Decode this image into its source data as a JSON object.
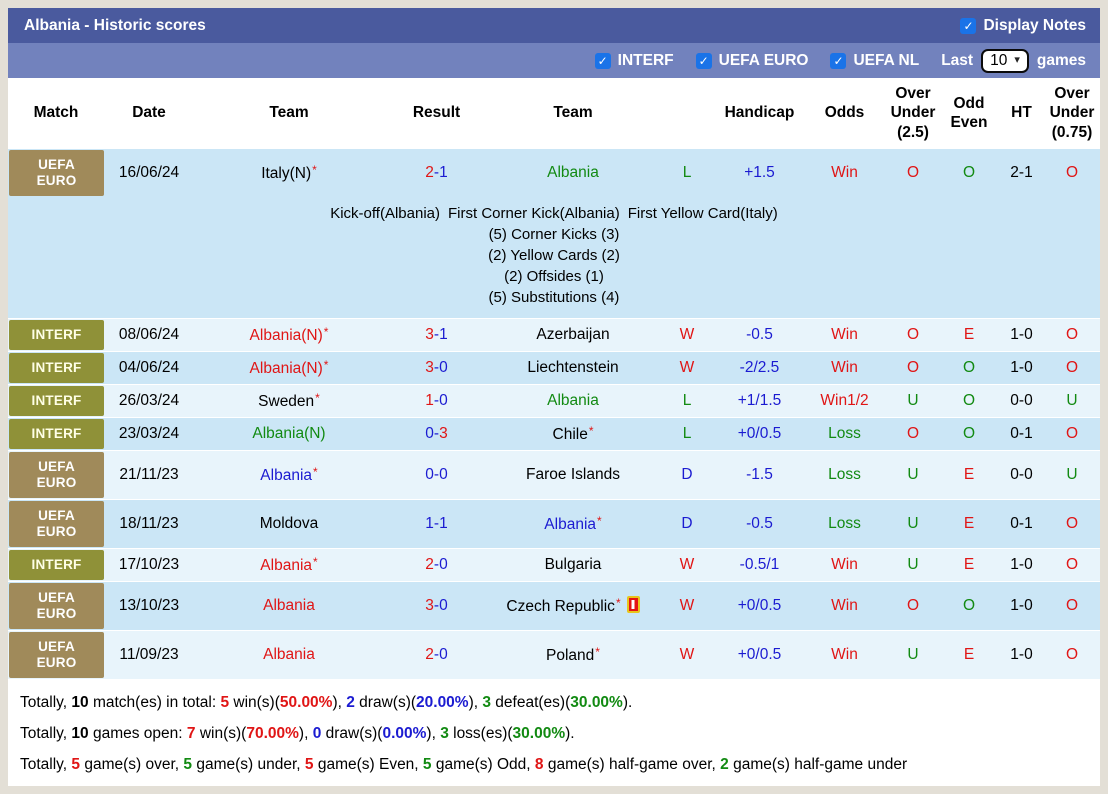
{
  "palette": {
    "title_bar": "#4a5a9e",
    "filter_bar": "#7282bd",
    "row_dark": "#cbe6f6",
    "row_light": "#e8f4fb",
    "badge_gold": "#a08a5a",
    "badge_olive": "#8f9138",
    "win_red": "#e01515",
    "draw_blue": "#1b1bd1",
    "loss_green": "#128a12",
    "checkbox_blue": "#1a73e8"
  },
  "title_bar": {
    "title": "Albania - Historic scores",
    "display_notes_label": "Display Notes",
    "display_notes_checked": true
  },
  "filter_bar": {
    "filters": [
      {
        "label": "INTERF",
        "checked": true
      },
      {
        "label": "UEFA EURO",
        "checked": true
      },
      {
        "label": "UEFA NL",
        "checked": true
      }
    ],
    "last_label": "Last",
    "last_value": "10",
    "games_label": "games"
  },
  "table": {
    "headers": {
      "match": "Match",
      "date": "Date",
      "team1": "Team",
      "result": "Result",
      "team2": "Team",
      "handicap": "Handicap",
      "odds": "Odds",
      "ou25": "Over\nUnder\n(2.5)",
      "oddeven": "Odd\nEven",
      "ht": "HT",
      "ou75": "Over\nUnder\n(0.75)"
    },
    "rows": [
      {
        "comp": "UEFA\nEURO",
        "comp_style": "gold",
        "date": "16/06/24",
        "home": {
          "name": "Italy(N)",
          "star": true,
          "color": "black"
        },
        "score": {
          "h": "2",
          "hc": "red",
          "a": "1",
          "ac": "blue"
        },
        "away": {
          "name": "Albania",
          "star": false,
          "color": "green"
        },
        "wdl": {
          "t": "L",
          "c": "green"
        },
        "hcp": "+1.5",
        "odds": {
          "t": "Win",
          "c": "red"
        },
        "ou25": {
          "t": "O",
          "c": "red"
        },
        "oe": {
          "t": "O",
          "c": "green"
        },
        "ht": "2-1",
        "ou75": {
          "t": "O",
          "c": "red"
        },
        "shade": "dark",
        "notes": {
          "first_events": [
            "Kick-off(Albania)",
            "First Corner Kick(Albania)",
            "First Yellow Card(Italy)"
          ],
          "stat_lines": [
            "(5) Corner Kicks (3)",
            "(2) Yellow Cards (2)",
            "(2) Offsides (1)",
            "(5) Substitutions (4)"
          ]
        }
      },
      {
        "comp": "INTERF",
        "comp_style": "olive",
        "date": "08/06/24",
        "home": {
          "name": "Albania(N)",
          "star": true,
          "color": "red"
        },
        "score": {
          "h": "3",
          "hc": "red",
          "a": "1",
          "ac": "blue"
        },
        "away": {
          "name": "Azerbaijan",
          "star": false,
          "color": "black"
        },
        "wdl": {
          "t": "W",
          "c": "red"
        },
        "hcp": "-0.5",
        "odds": {
          "t": "Win",
          "c": "red"
        },
        "ou25": {
          "t": "O",
          "c": "red"
        },
        "oe": {
          "t": "E",
          "c": "red"
        },
        "ht": "1-0",
        "ou75": {
          "t": "O",
          "c": "red"
        },
        "shade": "light"
      },
      {
        "comp": "INTERF",
        "comp_style": "olive",
        "date": "04/06/24",
        "home": {
          "name": "Albania(N)",
          "star": true,
          "color": "red"
        },
        "score": {
          "h": "3",
          "hc": "red",
          "a": "0",
          "ac": "blue"
        },
        "away": {
          "name": "Liechtenstein",
          "star": false,
          "color": "black"
        },
        "wdl": {
          "t": "W",
          "c": "red"
        },
        "hcp": "-2/2.5",
        "odds": {
          "t": "Win",
          "c": "red"
        },
        "ou25": {
          "t": "O",
          "c": "red"
        },
        "oe": {
          "t": "O",
          "c": "green"
        },
        "ht": "1-0",
        "ou75": {
          "t": "O",
          "c": "red"
        },
        "shade": "dark"
      },
      {
        "comp": "INTERF",
        "comp_style": "olive",
        "date": "26/03/24",
        "home": {
          "name": "Sweden",
          "star": true,
          "color": "black"
        },
        "score": {
          "h": "1",
          "hc": "red",
          "a": "0",
          "ac": "blue"
        },
        "away": {
          "name": "Albania",
          "star": false,
          "color": "green"
        },
        "wdl": {
          "t": "L",
          "c": "green"
        },
        "hcp": "+1/1.5",
        "odds": {
          "t": "Win1/2",
          "c": "red"
        },
        "ou25": {
          "t": "U",
          "c": "green"
        },
        "oe": {
          "t": "O",
          "c": "green"
        },
        "ht": "0-0",
        "ou75": {
          "t": "U",
          "c": "green"
        },
        "shade": "light"
      },
      {
        "comp": "INTERF",
        "comp_style": "olive",
        "date": "23/03/24",
        "home": {
          "name": "Albania(N)",
          "star": false,
          "color": "green"
        },
        "score": {
          "h": "0",
          "hc": "blue",
          "a": "3",
          "ac": "red"
        },
        "away": {
          "name": "Chile",
          "star": true,
          "color": "black"
        },
        "wdl": {
          "t": "L",
          "c": "green"
        },
        "hcp": "+0/0.5",
        "odds": {
          "t": "Loss",
          "c": "green"
        },
        "ou25": {
          "t": "O",
          "c": "red"
        },
        "oe": {
          "t": "O",
          "c": "green"
        },
        "ht": "0-1",
        "ou75": {
          "t": "O",
          "c": "red"
        },
        "shade": "dark"
      },
      {
        "comp": "UEFA\nEURO",
        "comp_style": "gold",
        "date": "21/11/23",
        "home": {
          "name": "Albania",
          "star": true,
          "color": "blue"
        },
        "score": {
          "h": "0",
          "hc": "blue",
          "a": "0",
          "ac": "blue"
        },
        "away": {
          "name": "Faroe Islands",
          "star": false,
          "color": "black"
        },
        "wdl": {
          "t": "D",
          "c": "blue"
        },
        "hcp": "-1.5",
        "odds": {
          "t": "Loss",
          "c": "green"
        },
        "ou25": {
          "t": "U",
          "c": "green"
        },
        "oe": {
          "t": "E",
          "c": "red"
        },
        "ht": "0-0",
        "ou75": {
          "t": "U",
          "c": "green"
        },
        "shade": "light"
      },
      {
        "comp": "UEFA\nEURO",
        "comp_style": "gold",
        "date": "18/11/23",
        "home": {
          "name": "Moldova",
          "star": false,
          "color": "black"
        },
        "score": {
          "h": "1",
          "hc": "blue",
          "a": "1",
          "ac": "blue"
        },
        "away": {
          "name": "Albania",
          "star": true,
          "color": "blue"
        },
        "wdl": {
          "t": "D",
          "c": "blue"
        },
        "hcp": "-0.5",
        "odds": {
          "t": "Loss",
          "c": "green"
        },
        "ou25": {
          "t": "U",
          "c": "green"
        },
        "oe": {
          "t": "E",
          "c": "red"
        },
        "ht": "0-1",
        "ou75": {
          "t": "O",
          "c": "red"
        },
        "shade": "dark"
      },
      {
        "comp": "INTERF",
        "comp_style": "olive",
        "date": "17/10/23",
        "home": {
          "name": "Albania",
          "star": true,
          "color": "red"
        },
        "score": {
          "h": "2",
          "hc": "red",
          "a": "0",
          "ac": "blue"
        },
        "away": {
          "name": "Bulgaria",
          "star": false,
          "color": "black"
        },
        "wdl": {
          "t": "W",
          "c": "red"
        },
        "hcp": "-0.5/1",
        "odds": {
          "t": "Win",
          "c": "red"
        },
        "ou25": {
          "t": "U",
          "c": "green"
        },
        "oe": {
          "t": "E",
          "c": "red"
        },
        "ht": "1-0",
        "ou75": {
          "t": "O",
          "c": "red"
        },
        "shade": "light"
      },
      {
        "comp": "UEFA\nEURO",
        "comp_style": "gold",
        "date": "13/10/23",
        "home": {
          "name": "Albania",
          "star": false,
          "color": "red"
        },
        "score": {
          "h": "3",
          "hc": "red",
          "a": "0",
          "ac": "blue"
        },
        "away": {
          "name": "Czech Republic",
          "star": true,
          "color": "black",
          "red_card": true
        },
        "wdl": {
          "t": "W",
          "c": "red"
        },
        "hcp": "+0/0.5",
        "odds": {
          "t": "Win",
          "c": "red"
        },
        "ou25": {
          "t": "O",
          "c": "red"
        },
        "oe": {
          "t": "O",
          "c": "green"
        },
        "ht": "1-0",
        "ou75": {
          "t": "O",
          "c": "red"
        },
        "shade": "dark"
      },
      {
        "comp": "UEFA\nEURO",
        "comp_style": "gold",
        "date": "11/09/23",
        "home": {
          "name": "Albania",
          "star": false,
          "color": "red"
        },
        "score": {
          "h": "2",
          "hc": "red",
          "a": "0",
          "ac": "blue"
        },
        "away": {
          "name": "Poland",
          "star": true,
          "color": "black"
        },
        "wdl": {
          "t": "W",
          "c": "red"
        },
        "hcp": "+0/0.5",
        "odds": {
          "t": "Win",
          "c": "red"
        },
        "ou25": {
          "t": "U",
          "c": "green"
        },
        "oe": {
          "t": "E",
          "c": "red"
        },
        "ht": "1-0",
        "ou75": {
          "t": "O",
          "c": "red"
        },
        "shade": "light"
      }
    ]
  },
  "footer": {
    "lines": [
      [
        {
          "t": "Totally, "
        },
        {
          "t": "10",
          "b": true
        },
        {
          "t": " match(es) in total: "
        },
        {
          "t": "5",
          "c": "red",
          "b": true
        },
        {
          "t": " win(s)("
        },
        {
          "t": "50.00%",
          "c": "red",
          "b": true
        },
        {
          "t": "), "
        },
        {
          "t": "2",
          "c": "blue",
          "b": true
        },
        {
          "t": " draw(s)("
        },
        {
          "t": "20.00%",
          "c": "blue",
          "b": true
        },
        {
          "t": "), "
        },
        {
          "t": "3",
          "c": "green",
          "b": true
        },
        {
          "t": " defeat(es)("
        },
        {
          "t": "30.00%",
          "c": "green",
          "b": true
        },
        {
          "t": ")."
        }
      ],
      [
        {
          "t": "Totally, "
        },
        {
          "t": "10",
          "b": true
        },
        {
          "t": " games open: "
        },
        {
          "t": "7",
          "c": "red",
          "b": true
        },
        {
          "t": " win(s)("
        },
        {
          "t": "70.00%",
          "c": "red",
          "b": true
        },
        {
          "t": "), "
        },
        {
          "t": "0",
          "c": "blue",
          "b": true
        },
        {
          "t": " draw(s)("
        },
        {
          "t": "0.00%",
          "c": "blue",
          "b": true
        },
        {
          "t": "), "
        },
        {
          "t": "3",
          "c": "green",
          "b": true
        },
        {
          "t": " loss(es)("
        },
        {
          "t": "30.00%",
          "c": "green",
          "b": true
        },
        {
          "t": ")."
        }
      ],
      [
        {
          "t": "Totally, "
        },
        {
          "t": "5",
          "c": "red",
          "b": true
        },
        {
          "t": " game(s) over, "
        },
        {
          "t": "5",
          "c": "green",
          "b": true
        },
        {
          "t": " game(s) under, "
        },
        {
          "t": "5",
          "c": "red",
          "b": true
        },
        {
          "t": " game(s) Even, "
        },
        {
          "t": "5",
          "c": "green",
          "b": true
        },
        {
          "t": " game(s) Odd, "
        },
        {
          "t": "8",
          "c": "red",
          "b": true
        },
        {
          "t": " game(s) half-game over, "
        },
        {
          "t": "2",
          "c": "green",
          "b": true
        },
        {
          "t": " game(s) half-game under"
        }
      ]
    ]
  }
}
